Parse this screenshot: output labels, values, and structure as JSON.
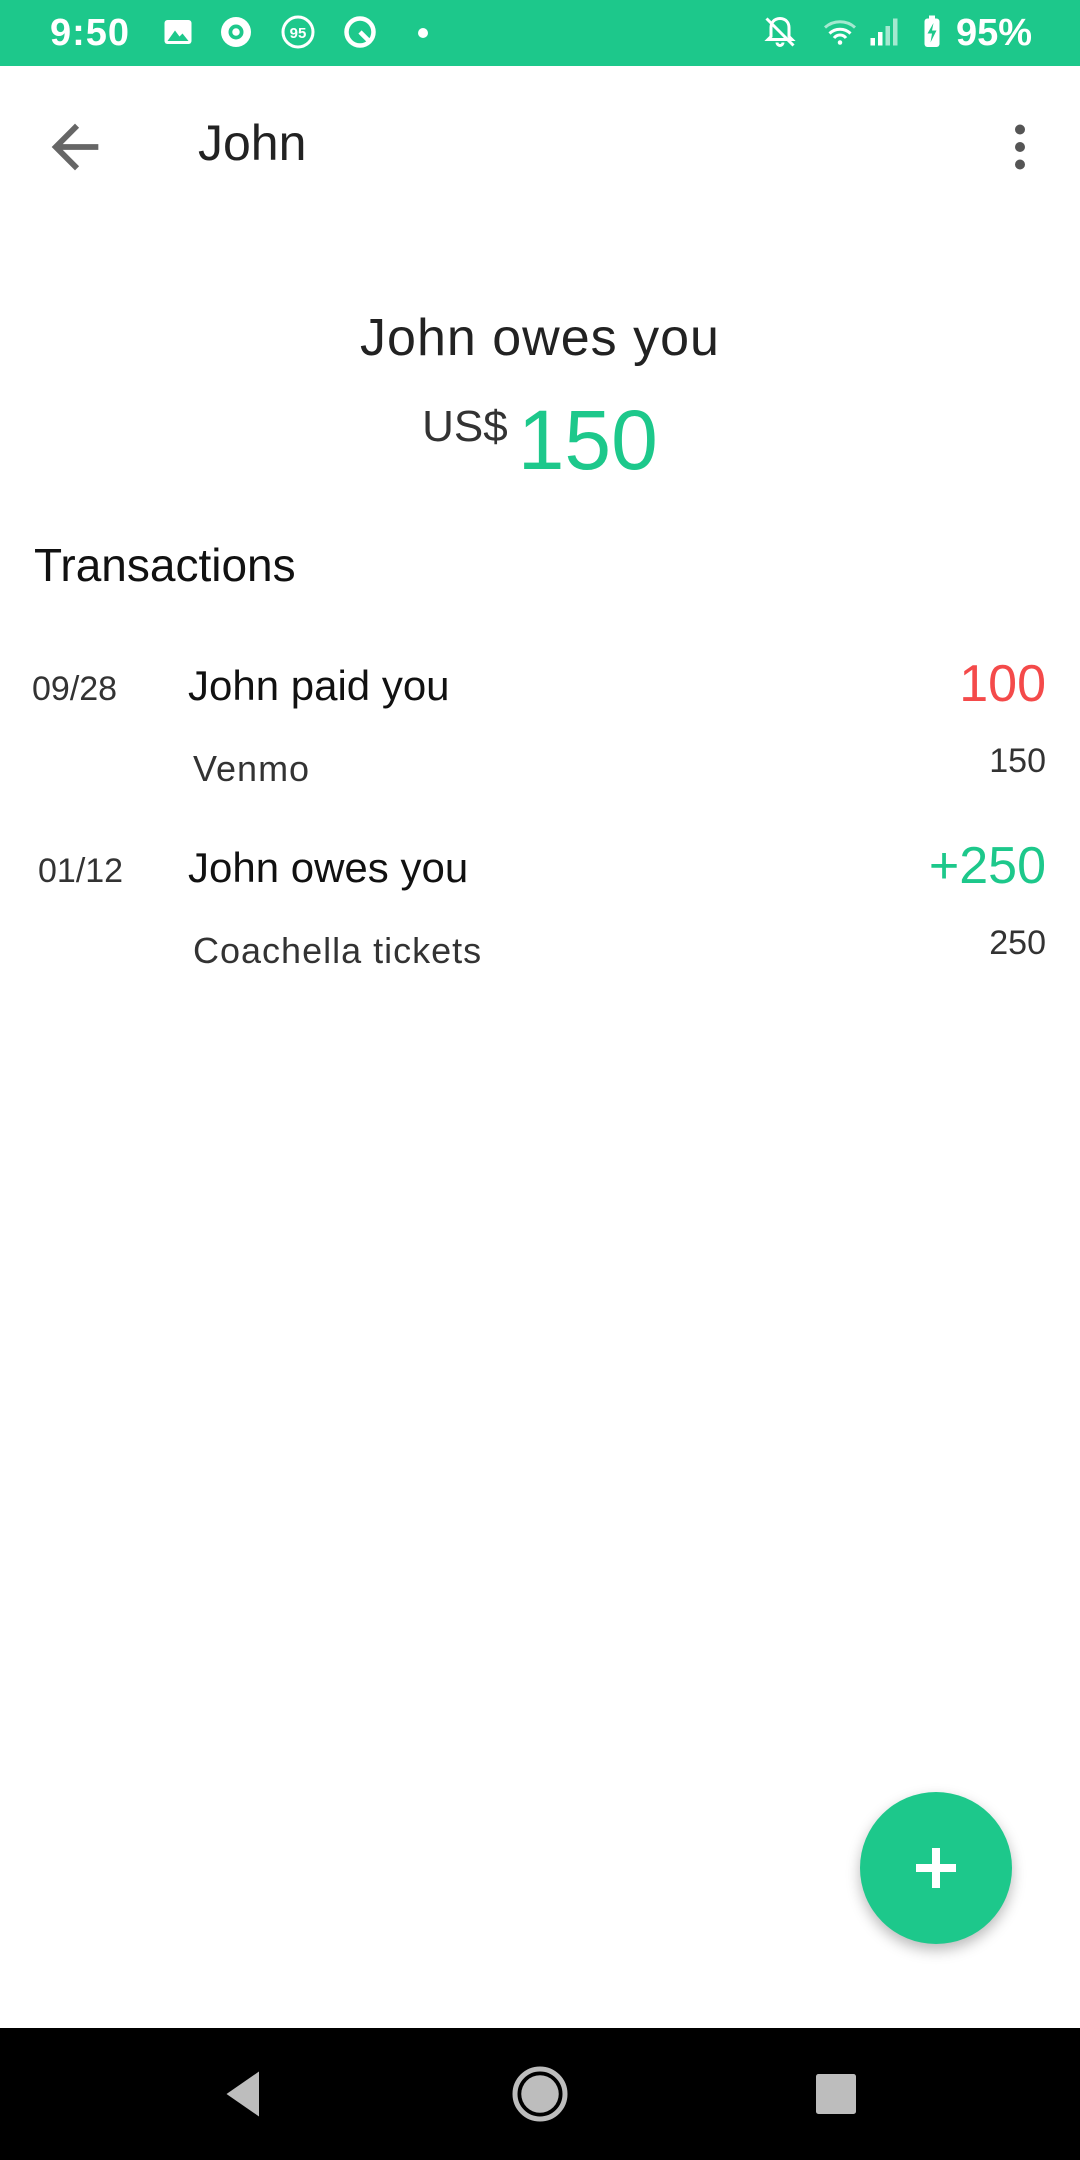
{
  "status_bar": {
    "time": "9:50",
    "battery_percent": "95%",
    "icons": [
      "image-icon",
      "starbucks-icon",
      "badge-95-icon",
      "q-app-icon",
      "dot-icon",
      "bell-off-icon",
      "wifi-icon",
      "signal-icon",
      "battery-charging-icon"
    ]
  },
  "app_bar": {
    "title": "John",
    "back_icon": "arrow-back-icon",
    "more_icon": "more-vertical-icon"
  },
  "summary": {
    "label": "John owes you",
    "currency": "US$",
    "amount": "150",
    "amount_color": "#1dc88b"
  },
  "transactions_section": {
    "title": "Transactions",
    "items": [
      {
        "date": "09/28",
        "title": "John paid you",
        "amount": "100",
        "amount_color": "#f44a4a",
        "note": "Venmo",
        "running_total": "150"
      },
      {
        "date": "01/12",
        "title": "John owes you",
        "amount": "+250",
        "amount_color": "#1dc88b",
        "note": "Coachella tickets",
        "running_total": "250"
      }
    ]
  },
  "fab": {
    "icon": "plus-icon"
  },
  "nav_bar": {
    "icons": [
      "back-triangle-icon",
      "home-circle-icon",
      "recents-square-icon"
    ]
  },
  "colors": {
    "accent": "#1dc88b",
    "negative": "#f44a4a"
  }
}
